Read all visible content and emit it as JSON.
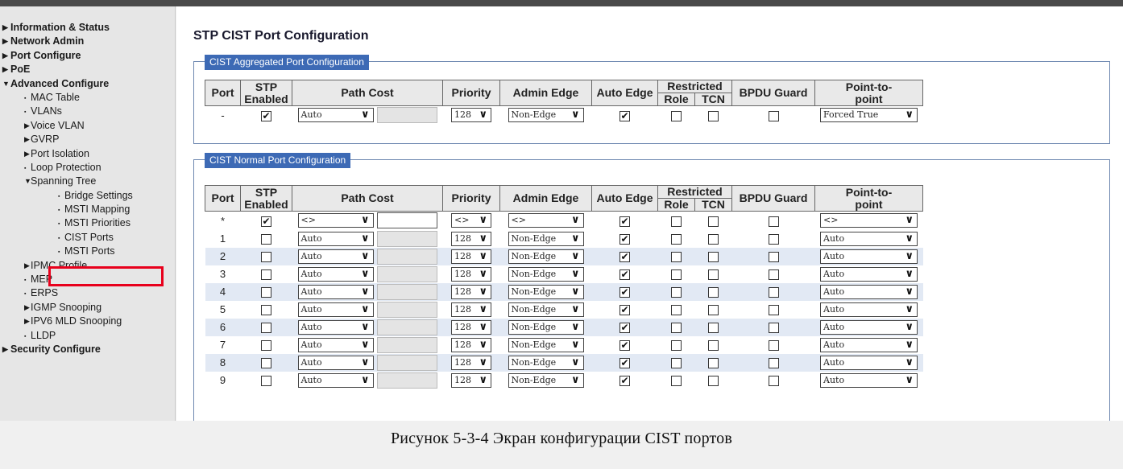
{
  "sidebar": {
    "items": [
      {
        "label": "Information & Status",
        "level": 0,
        "icon": "triangle-right-icon"
      },
      {
        "label": "Network Admin",
        "level": 0,
        "icon": "triangle-right-icon"
      },
      {
        "label": "Port Configure",
        "level": 0,
        "icon": "triangle-right-icon"
      },
      {
        "label": "PoE",
        "level": 0,
        "icon": "triangle-right-icon"
      },
      {
        "label": "Advanced Configure",
        "level": 0,
        "icon": "triangle-down-icon"
      },
      {
        "label": "MAC Table",
        "level": 1,
        "icon": "bullet-icon"
      },
      {
        "label": "VLANs",
        "level": 1,
        "icon": "bullet-icon"
      },
      {
        "label": "Voice VLAN",
        "level": 1,
        "icon": "triangle-right-icon"
      },
      {
        "label": "GVRP",
        "level": 1,
        "icon": "triangle-right-icon"
      },
      {
        "label": "Port Isolation",
        "level": 1,
        "icon": "triangle-right-icon"
      },
      {
        "label": "Loop Protection",
        "level": 1,
        "icon": "bullet-icon"
      },
      {
        "label": "Spanning Tree",
        "level": 1,
        "icon": "triangle-down-icon"
      },
      {
        "label": "Bridge Settings",
        "level": 2,
        "icon": "bullet-icon"
      },
      {
        "label": "MSTI Mapping",
        "level": 2,
        "icon": "bullet-icon"
      },
      {
        "label": "MSTI Priorities",
        "level": 2,
        "icon": "bullet-icon"
      },
      {
        "label": "CIST Ports",
        "level": 2,
        "icon": "bullet-icon",
        "selected": true
      },
      {
        "label": "MSTI Ports",
        "level": 2,
        "icon": "bullet-icon"
      },
      {
        "label": "IPMC Profile",
        "level": 1,
        "icon": "triangle-right-icon"
      },
      {
        "label": "MEP",
        "level": 1,
        "icon": "bullet-icon"
      },
      {
        "label": "ERPS",
        "level": 1,
        "icon": "bullet-icon"
      },
      {
        "label": "IGMP Snooping",
        "level": 1,
        "icon": "triangle-right-icon"
      },
      {
        "label": "IPV6 MLD Snooping",
        "level": 1,
        "icon": "triangle-right-icon"
      },
      {
        "label": "LLDP",
        "level": 1,
        "icon": "bullet-icon"
      },
      {
        "label": "Security Configure",
        "level": 0,
        "icon": "triangle-right-icon"
      }
    ]
  },
  "main": {
    "title": "STP CIST Port Configuration",
    "headers": {
      "port": "Port",
      "stp_enabled": "STP Enabled",
      "path_cost": "Path Cost",
      "priority": "Priority",
      "admin_edge": "Admin Edge",
      "auto_edge": "Auto Edge",
      "restricted": "Restricted",
      "role": "Role",
      "tcn": "TCN",
      "bpdu_guard": "BPDU Guard",
      "point_to_point": "Point-to-point"
    },
    "aggregated": {
      "legend": "CIST Aggregated Port Configuration",
      "rows": [
        {
          "port": "-",
          "stp_enabled": true,
          "path_cost_mode": "Auto",
          "path_cost_value": "",
          "priority": "128",
          "admin_edge": "Non-Edge",
          "auto_edge": true,
          "role": false,
          "tcn": false,
          "bpdu_guard": false,
          "p2p": "Forced True"
        }
      ]
    },
    "normal": {
      "legend": "CIST Normal Port Configuration",
      "rows": [
        {
          "port": "*",
          "stp_enabled": true,
          "path_cost_mode": "<>",
          "path_cost_value": "",
          "priority": "<>",
          "admin_edge": "<>",
          "auto_edge": true,
          "role": false,
          "tcn": false,
          "bpdu_guard": false,
          "p2p": "<>"
        },
        {
          "port": "1",
          "stp_enabled": false,
          "path_cost_mode": "Auto",
          "path_cost_value": "",
          "priority": "128",
          "admin_edge": "Non-Edge",
          "auto_edge": true,
          "role": false,
          "tcn": false,
          "bpdu_guard": false,
          "p2p": "Auto"
        },
        {
          "port": "2",
          "stp_enabled": false,
          "path_cost_mode": "Auto",
          "path_cost_value": "",
          "priority": "128",
          "admin_edge": "Non-Edge",
          "auto_edge": true,
          "role": false,
          "tcn": false,
          "bpdu_guard": false,
          "p2p": "Auto"
        },
        {
          "port": "3",
          "stp_enabled": false,
          "path_cost_mode": "Auto",
          "path_cost_value": "",
          "priority": "128",
          "admin_edge": "Non-Edge",
          "auto_edge": true,
          "role": false,
          "tcn": false,
          "bpdu_guard": false,
          "p2p": "Auto"
        },
        {
          "port": "4",
          "stp_enabled": false,
          "path_cost_mode": "Auto",
          "path_cost_value": "",
          "priority": "128",
          "admin_edge": "Non-Edge",
          "auto_edge": true,
          "role": false,
          "tcn": false,
          "bpdu_guard": false,
          "p2p": "Auto"
        },
        {
          "port": "5",
          "stp_enabled": false,
          "path_cost_mode": "Auto",
          "path_cost_value": "",
          "priority": "128",
          "admin_edge": "Non-Edge",
          "auto_edge": true,
          "role": false,
          "tcn": false,
          "bpdu_guard": false,
          "p2p": "Auto"
        },
        {
          "port": "6",
          "stp_enabled": false,
          "path_cost_mode": "Auto",
          "path_cost_value": "",
          "priority": "128",
          "admin_edge": "Non-Edge",
          "auto_edge": true,
          "role": false,
          "tcn": false,
          "bpdu_guard": false,
          "p2p": "Auto"
        },
        {
          "port": "7",
          "stp_enabled": false,
          "path_cost_mode": "Auto",
          "path_cost_value": "",
          "priority": "128",
          "admin_edge": "Non-Edge",
          "auto_edge": true,
          "role": false,
          "tcn": false,
          "bpdu_guard": false,
          "p2p": "Auto"
        },
        {
          "port": "8",
          "stp_enabled": false,
          "path_cost_mode": "Auto",
          "path_cost_value": "",
          "priority": "128",
          "admin_edge": "Non-Edge",
          "auto_edge": true,
          "role": false,
          "tcn": false,
          "bpdu_guard": false,
          "p2p": "Auto"
        },
        {
          "port": "9",
          "stp_enabled": false,
          "path_cost_mode": "Auto",
          "path_cost_value": "",
          "priority": "128",
          "admin_edge": "Non-Edge",
          "auto_edge": true,
          "role": false,
          "tcn": false,
          "bpdu_guard": false,
          "p2p": "Auto"
        }
      ]
    }
  },
  "caption": "Рисунок 5-3-4 Экран конфигурации CIST портов",
  "colors": {
    "legend_bg": "#3d6ab5",
    "highlight_box": "#e8001c",
    "row_alt": "#e2e9f4",
    "header_bg": "#e9e9e9"
  }
}
